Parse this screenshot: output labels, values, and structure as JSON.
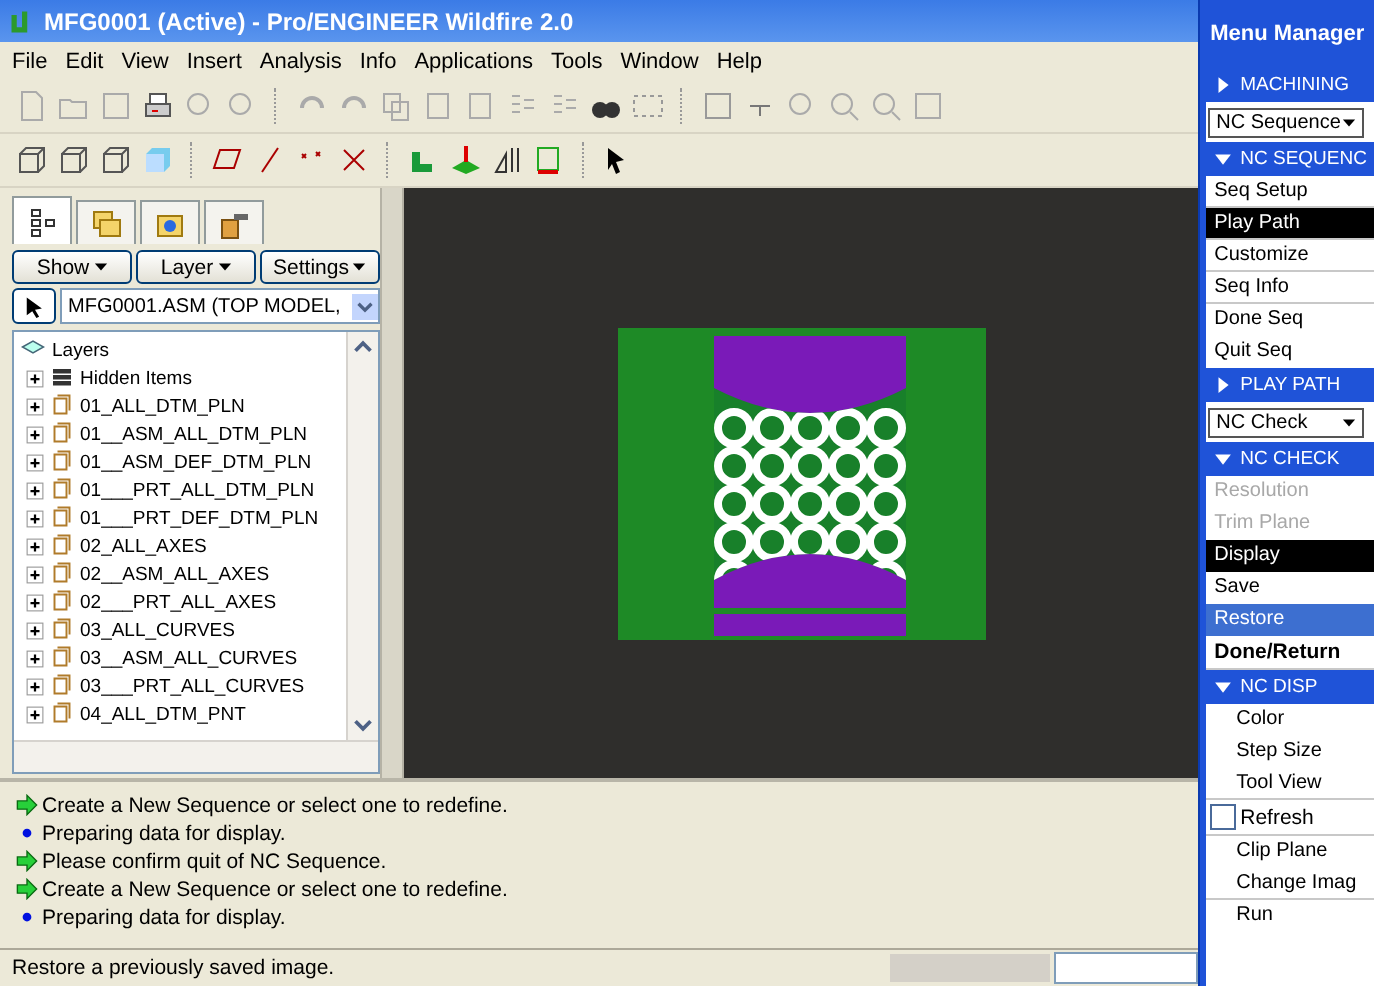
{
  "window": {
    "title": "MFG0001 (Active) - Pro/ENGINEER Wildfire 2.0"
  },
  "menu_bar": [
    "File",
    "Edit",
    "View",
    "Insert",
    "Analysis",
    "Info",
    "Applications",
    "Tools",
    "Window",
    "Help"
  ],
  "panel_tabs": [
    {
      "kind": "tree",
      "selected": true
    },
    {
      "kind": "folders",
      "selected": false
    },
    {
      "kind": "favorites",
      "selected": false
    },
    {
      "kind": "tools",
      "selected": false
    }
  ],
  "panel_buttons": [
    "Show",
    "Layer",
    "Settings"
  ],
  "model_select": {
    "value": "MFG0001.ASM (TOP MODEL,"
  },
  "layer_tree": {
    "label": "Layers",
    "children": [
      {
        "label": "Hidden Items",
        "kind": "hidden",
        "expanded": false
      },
      {
        "label": "01_ALL_DTM_PLN",
        "kind": "layer",
        "expanded": false
      },
      {
        "label": "01__ASM_ALL_DTM_PLN",
        "kind": "layer",
        "expanded": false
      },
      {
        "label": "01__ASM_DEF_DTM_PLN",
        "kind": "layer",
        "expanded": false
      },
      {
        "label": "01___PRT_ALL_DTM_PLN",
        "kind": "layer",
        "expanded": false
      },
      {
        "label": "01___PRT_DEF_DTM_PLN",
        "kind": "layer",
        "expanded": false
      },
      {
        "label": "02_ALL_AXES",
        "kind": "layer",
        "expanded": false
      },
      {
        "label": "02__ASM_ALL_AXES",
        "kind": "layer",
        "expanded": false
      },
      {
        "label": "02___PRT_ALL_AXES",
        "kind": "layer",
        "expanded": false
      },
      {
        "label": "03_ALL_CURVES",
        "kind": "layer",
        "expanded": false
      },
      {
        "label": "03__ASM_ALL_CURVES",
        "kind": "layer",
        "expanded": false
      },
      {
        "label": "03___PRT_ALL_CURVES",
        "kind": "layer",
        "expanded": false
      },
      {
        "label": "04_ALL_DTM_PNT",
        "kind": "layer",
        "expanded": false
      }
    ]
  },
  "messages": [
    {
      "kind": "prompt",
      "text": "Create a New Sequence or select one to redefine."
    },
    {
      "kind": "info",
      "text": "Preparing data for display."
    },
    {
      "kind": "prompt",
      "text": "Please confirm quit of NC Sequence."
    },
    {
      "kind": "prompt",
      "text": "Create a New Sequence or select one to redefine."
    },
    {
      "kind": "info",
      "text": "Preparing data for display."
    }
  ],
  "status_bar": {
    "text": "Restore a previously saved image."
  },
  "menu_manager": {
    "title": "Menu Manager",
    "items": [
      {
        "kind": "header",
        "label": "MACHINING",
        "expanded": false
      },
      {
        "kind": "dropdown",
        "label": "NC Sequence"
      },
      {
        "kind": "header",
        "label": "NC SEQUENC",
        "expanded": true
      },
      {
        "kind": "item",
        "label": "Seq Setup",
        "selected": false,
        "highlighted": false,
        "disabled": false,
        "divider": true
      },
      {
        "kind": "item",
        "label": "Play Path",
        "selected": true,
        "highlighted": false,
        "disabled": false,
        "divider": true
      },
      {
        "kind": "item",
        "label": "Customize",
        "selected": false,
        "highlighted": false,
        "disabled": false,
        "divider": true
      },
      {
        "kind": "item",
        "label": "Seq Info",
        "selected": false,
        "highlighted": false,
        "disabled": false,
        "divider": true
      },
      {
        "kind": "item",
        "label": "Done Seq",
        "selected": false,
        "highlighted": false,
        "disabled": false,
        "divider": false
      },
      {
        "kind": "item",
        "label": "Quit Seq",
        "selected": false,
        "highlighted": false,
        "disabled": false,
        "divider": false
      },
      {
        "kind": "header",
        "label": "PLAY PATH",
        "expanded": false
      },
      {
        "kind": "dropdown",
        "label": "NC Check"
      },
      {
        "kind": "header",
        "label": "NC CHECK",
        "expanded": true
      },
      {
        "kind": "item",
        "label": "Resolution",
        "selected": false,
        "highlighted": false,
        "disabled": true,
        "divider": false
      },
      {
        "kind": "item",
        "label": "Trim Plane",
        "selected": false,
        "highlighted": false,
        "disabled": true,
        "divider": false
      },
      {
        "kind": "item",
        "label": "Display",
        "selected": true,
        "highlighted": false,
        "disabled": false,
        "divider": false
      },
      {
        "kind": "item",
        "label": "Save",
        "selected": false,
        "highlighted": false,
        "disabled": false,
        "divider": false
      },
      {
        "kind": "item",
        "label": "Restore",
        "selected": false,
        "highlighted": true,
        "disabled": false,
        "divider": false
      },
      {
        "kind": "done",
        "label": "Done/Return"
      },
      {
        "kind": "header",
        "label": "NC DISP",
        "expanded": true
      },
      {
        "kind": "item",
        "label": "Color",
        "selected": false,
        "highlighted": false,
        "disabled": false,
        "divider": false,
        "indent": true
      },
      {
        "kind": "item",
        "label": "Step Size",
        "selected": false,
        "highlighted": false,
        "disabled": false,
        "divider": false,
        "indent": true
      },
      {
        "kind": "item",
        "label": "Tool View",
        "selected": false,
        "highlighted": false,
        "disabled": false,
        "divider": true,
        "indent": true
      },
      {
        "kind": "checkbox",
        "label": "Refresh",
        "checked": false
      },
      {
        "kind": "item",
        "label": "Clip Plane",
        "selected": false,
        "highlighted": false,
        "disabled": false,
        "divider": false,
        "indent": true
      },
      {
        "kind": "item",
        "label": "Change Imag",
        "selected": false,
        "highlighted": false,
        "disabled": false,
        "divider": true,
        "indent": true
      },
      {
        "kind": "item",
        "label": "Run",
        "selected": false,
        "highlighted": false,
        "disabled": false,
        "divider": false,
        "indent": true
      }
    ]
  }
}
